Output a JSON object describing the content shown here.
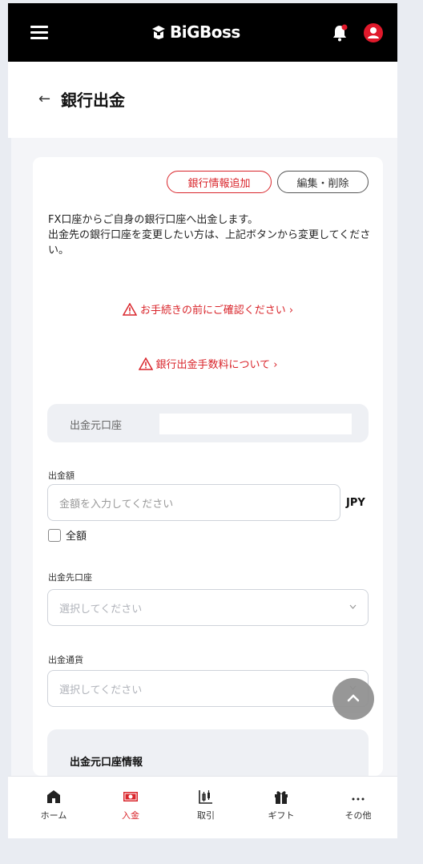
{
  "app": {
    "logo_text": "BiGBoss"
  },
  "header": {
    "back_label": "←",
    "title": "銀行出金"
  },
  "actions": {
    "add_bank_label": "銀行情報追加",
    "edit_delete_label": "編集・削除"
  },
  "description": {
    "line1": "FX口座からご自身の銀行口座へ出金します。",
    "line2": "出金先の銀行口座を変更したい方は、上記ボタンから変更してください。"
  },
  "links": {
    "confirm_before": "お手続きの前にご確認ください ›",
    "fee_info": "銀行出金手数料について ›"
  },
  "source_account": {
    "label": "出金元口座",
    "value": ""
  },
  "amount": {
    "label": "出金額",
    "placeholder": "金額を入力してください",
    "currency": "JPY",
    "full_amount_label": "全額",
    "full_amount_checked": false
  },
  "destination": {
    "label": "出金先口座",
    "placeholder": "選択してください"
  },
  "withdraw_currency": {
    "label": "出金通貨",
    "placeholder": "選択してください"
  },
  "info_section": {
    "title": "出金元口座情報"
  },
  "bottom_nav": {
    "items": [
      {
        "label": "ホーム",
        "icon": "home-icon",
        "active": false
      },
      {
        "label": "入金",
        "icon": "deposit-icon",
        "active": true
      },
      {
        "label": "取引",
        "icon": "trade-icon",
        "active": false
      },
      {
        "label": "ギフト",
        "icon": "gift-icon",
        "active": false
      },
      {
        "label": "その他",
        "icon": "more-icon",
        "active": false
      }
    ]
  },
  "colors": {
    "accent": "#d9252b",
    "topbar": "#000000"
  }
}
